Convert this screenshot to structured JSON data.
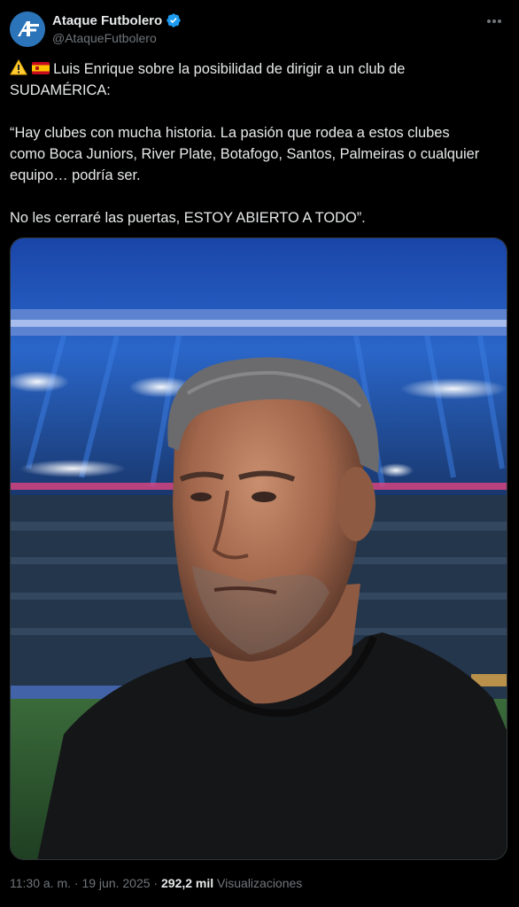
{
  "author": {
    "display_name": "Ataque Futbolero",
    "handle": "@AtaqueFutbolero",
    "verified": true,
    "avatar_text": "A"
  },
  "tweet": {
    "line1": "Luis Enrique sobre la posibilidad de dirigir a un club de",
    "line2": "SUDAMÉRICA:",
    "quote_line1": "“Hay clubes con mucha historia. La pasión que rodea a estos clubes",
    "quote_line2": "como Boca Juniors, River Plate, Botafogo, Santos, Palmeiras o cualquier",
    "quote_line3": "equipo… podría ser.",
    "closing": "No les cerraré las puertas, ESTOY ABIERTO A TODO”.",
    "emojis": [
      "warning-icon",
      "spain-flag-icon"
    ]
  },
  "meta": {
    "time": "11:30 a. m.",
    "separator1": " · ",
    "date": "19 jun. 2025",
    "separator2": " · ",
    "views_count": "292,2 mil",
    "views_label": " Visualizaciones"
  },
  "colors": {
    "background": "#000000",
    "text": "#e7e9ea",
    "secondary": "#71767b",
    "verified": "#1d9bf0",
    "avatar": "#2b74b9"
  }
}
